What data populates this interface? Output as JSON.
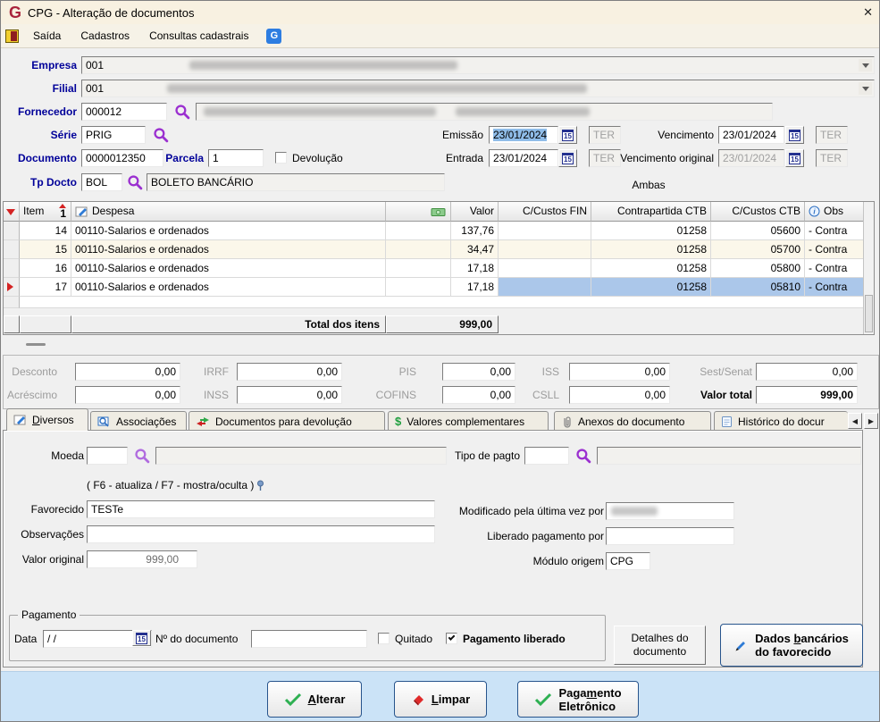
{
  "window": {
    "title": "CPG - Alteração de documentos"
  },
  "icons": {
    "logo_g": "G",
    "menu_g": "G",
    "close": "✕",
    "arrow_left": "◀",
    "arrow_right": "▶",
    "dollar": "$",
    "cal": "15"
  },
  "colors": {
    "accent_navy": "#000099",
    "selection_blue": "#ABC7EA",
    "bottom_strip": "#CBE3F7",
    "magnifier_purple": "#9B30D0",
    "marker_red": "#D42222",
    "check_green": "#2EB052",
    "titlebar_cream": "#F8F1E1"
  },
  "menu": {
    "saida": "Saída",
    "cadastros": "Cadastros",
    "consultas": "Consultas cadastrais"
  },
  "form": {
    "empresa_label": "Empresa",
    "empresa_code": "001",
    "filial_label": "Filial",
    "filial_code": "001",
    "fornecedor_label": "Fornecedor",
    "fornecedor_code": "000012",
    "serie_label": "Série",
    "serie_code": "PRIG",
    "documento_label": "Documento",
    "documento_value": "0000012350",
    "parcela_label": "Parcela",
    "parcela_value": "1",
    "devolucao_label": "Devolução",
    "tpdocto_label": "Tp Docto",
    "tpdocto_code": "BOL",
    "tpdocto_desc": "BOLETO BANCÁRIO",
    "emissao_label": "Emissão",
    "emissao_date": "23/01/2024",
    "emissao_dow": "TER",
    "vencimento_label": "Vencimento",
    "vencimento_date": "23/01/2024",
    "vencimento_dow": "TER",
    "entrada_label": "Entrada",
    "entrada_date": "23/01/2024",
    "entrada_dow": "TER",
    "venc_orig_label": "Vencimento original",
    "venc_orig_date": "23/01/2024",
    "venc_orig_dow": "TER",
    "ambas_label": "Ambas"
  },
  "grid": {
    "col_item": "Item",
    "col_sort": "1",
    "col_despesa": "Despesa",
    "col_valor": "Valor",
    "col_cfin": "C/Custos FIN",
    "col_contrapartida": "Contrapartida CTB",
    "col_cctb": "C/Custos CTB",
    "col_obs": "Obs",
    "rows": [
      {
        "item": "14",
        "despesa": "00110-Salarios e ordenados",
        "valor": "137,76",
        "cfin": "",
        "contrapartida": "01258",
        "cctb": "05600",
        "obs": "- Contra"
      },
      {
        "item": "15",
        "despesa": "00110-Salarios e ordenados",
        "valor": "34,47",
        "cfin": "",
        "contrapartida": "01258",
        "cctb": "05700",
        "obs": "- Contra"
      },
      {
        "item": "16",
        "despesa": "00110-Salarios e ordenados",
        "valor": "17,18",
        "cfin": "",
        "contrapartida": "01258",
        "cctb": "05800",
        "obs": "- Contra"
      },
      {
        "item": "17",
        "despesa": "00110-Salarios e ordenados",
        "valor": "17,18",
        "cfin": "",
        "contrapartida": "01258",
        "cctb": "05810",
        "obs": "- Contra"
      }
    ],
    "footer_label": "Total dos itens",
    "footer_value": "999,00"
  },
  "totals": {
    "desconto_label": "Desconto",
    "desconto": "0,00",
    "irrf_label": "IRRF",
    "irrf": "0,00",
    "pis_label": "PIS",
    "pis": "0,00",
    "iss_label": "ISS",
    "iss": "0,00",
    "sest_label": "Sest/Senat",
    "sest": "0,00",
    "acrescimo_label": "Acréscimo",
    "acrescimo": "0,00",
    "inss_label": "INSS",
    "inss": "0,00",
    "cofins_label": "COFINS",
    "cofins": "0,00",
    "csll_label": "CSLL",
    "csll": "0,00",
    "valor_total_label": "Valor total",
    "valor_total": "999,00"
  },
  "tabs": {
    "diversos_key": "D",
    "diversos_rest": "iversos",
    "associacoes": "Associações",
    "documentos": "Documentos para devolução",
    "valores": "Valores complementares",
    "anexos": "Anexos do documento",
    "historico": "Histórico do docur"
  },
  "diversos": {
    "moeda_label": "Moeda",
    "tipo_pagto_label": "Tipo de pagto",
    "hint": "( F6 - atualiza / F7 - mostra/oculta )",
    "favorecido_label": "Favorecido",
    "favorecido_value": "TESTe",
    "observacoes_label": "Observações",
    "observacoes_value": "",
    "valor_original_label": "Valor original",
    "valor_original_value": "999,00",
    "modificado_label": "Modificado pela última vez por",
    "liberado_label": "Liberado pagamento por",
    "liberado_value": "",
    "modulo_label": "Módulo origem",
    "modulo_value": "CPG",
    "pagamento_title": "Pagamento",
    "data_label": "Data",
    "data_value": "/ /",
    "num_doc_label": "Nº do documento",
    "num_doc_value": "",
    "quitado_label": "Quitado",
    "pag_liberado_label": "Pagamento liberado",
    "detalhes_btn_l1": "Detalhes do",
    "detalhes_btn_l2": "documento",
    "dados_btn_pre": "Dados ",
    "dados_btn_key": "b",
    "dados_btn_post": "ancários",
    "dados_btn_l2": "do favorecido"
  },
  "actions": {
    "alterar_key": "A",
    "alterar_rest": "lterar",
    "limpar_key": "L",
    "limpar_rest": "impar",
    "pag_pre": "Paga",
    "pag_key": "m",
    "pag_post": "ento",
    "pag_l2": "Eletrônico"
  }
}
